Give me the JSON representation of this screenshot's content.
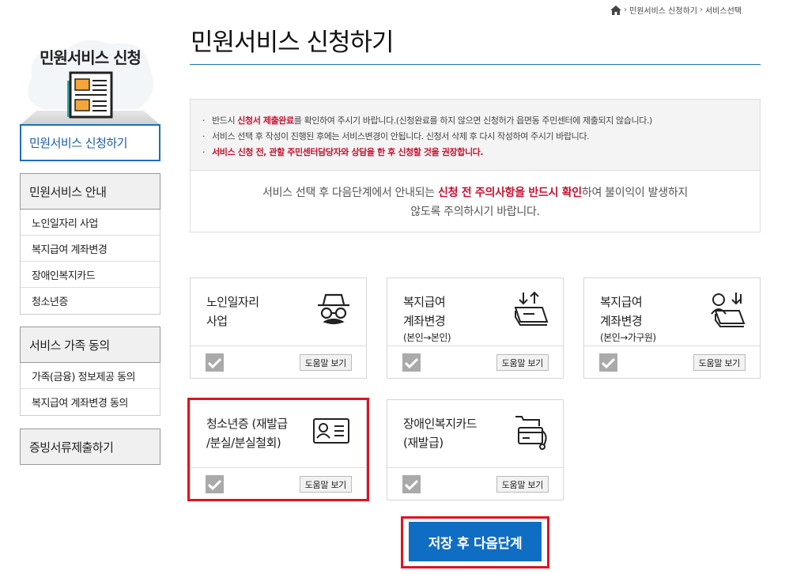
{
  "breadcrumb": {
    "home_icon": "home-icon",
    "items": [
      "민원서비스 신청하기",
      "서비스선택"
    ]
  },
  "sidebar": {
    "title": "민원서비스 신청",
    "active": "민원서비스 신청하기",
    "groups": [
      {
        "head": "민원서비스 안내",
        "items": [
          "노인일자리 사업",
          "복지급여 계좌변경",
          "장애인복지카드",
          "청소년증"
        ]
      },
      {
        "head": "서비스 가족 동의",
        "items": [
          "가족(금융) 정보제공 동의",
          "복지급여 계좌변경 동의"
        ]
      },
      {
        "head": "증빙서류제출하기",
        "items": []
      }
    ]
  },
  "page": {
    "title": "민원서비스 신청하기"
  },
  "notice": {
    "line1_a": "반드시 ",
    "line1_red": "신청서 제출완료",
    "line1_b": "를 확인하여 주시기 바랍니다.(신청완료를 하지 않으면 신청허가 읍면동 주민센터에 제출되지 않습니다.)",
    "line2": "서비스 선택 후 작성이 진행된 후에는 서비스변경이 안됩니다. 신청서 삭제 후 다시 작성하여 주시기 바랍니다.",
    "line3": "서비스 신청 전, 관할 주민센터담당자와 상담을 한 후 신청할 것을 권장합니다.",
    "bottom_a": "서비스 선택 후 다음단계에서 안내되는 ",
    "bottom_red": "신청 전 주의사항을 반드시 확인",
    "bottom_b": "하여 불이익이 발생하지",
    "bottom_c": "않도록 주의하시기 바랍니다."
  },
  "cards": [
    {
      "line1": "노인일자리",
      "line2": "사업",
      "sub": "",
      "icon": "elderly-person-icon",
      "help": "도움말 보기"
    },
    {
      "line1": "복지급여",
      "line2": "계좌변경",
      "sub": "(본인→본인)",
      "icon": "account-transfer-icon",
      "help": "도움말 보기"
    },
    {
      "line1": "복지급여",
      "line2": "계좌변경",
      "sub": "(본인→가구원)",
      "icon": "family-account-transfer-icon",
      "help": "도움말 보기"
    },
    {
      "line1": "청소년증 (재발급",
      "line2": "/분실/분실철회)",
      "sub": "",
      "icon": "id-card-icon",
      "help": "도움말 보기"
    },
    {
      "line1": "장애인복지카드",
      "line2": "(재발급)",
      "sub": "",
      "icon": "welfare-card-icon",
      "help": "도움말 보기"
    }
  ],
  "next_button": "저장 후 다음단계",
  "colors": {
    "accent": "#0f6dc4",
    "highlight": "#e0131e",
    "warning": "#c8102e"
  }
}
